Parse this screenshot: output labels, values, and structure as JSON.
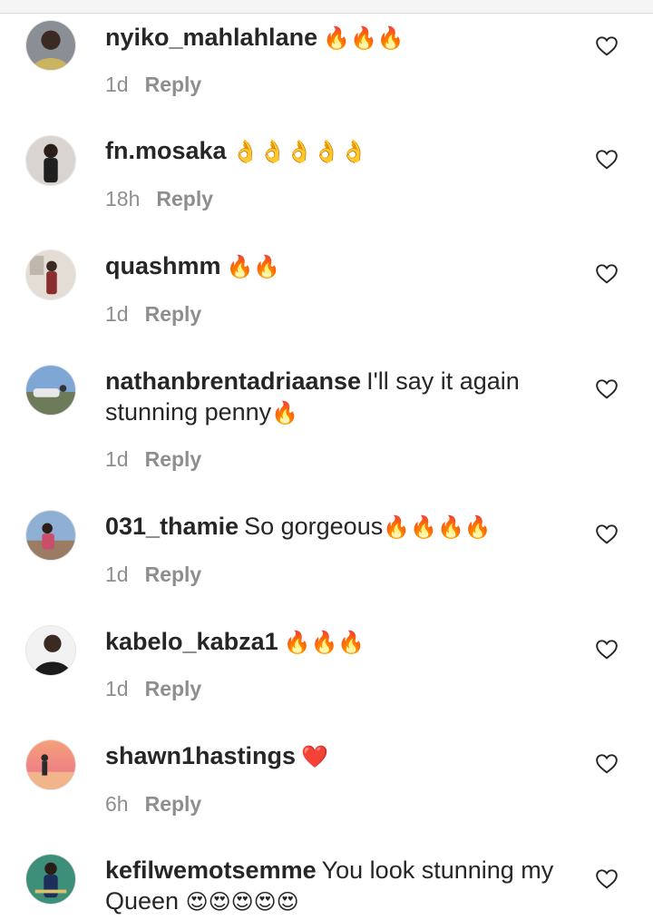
{
  "colors": {
    "text": "#262626",
    "meta": "#8e8e8e",
    "background": "#ffffff"
  },
  "icons": {
    "like": "heart-outline-icon",
    "fire": "🔥",
    "ok_hand": "👌",
    "red_heart": "❤️",
    "heart_eyes": "😍"
  },
  "comments": [
    {
      "username": "nyiko_mahlahlane",
      "text": "",
      "emoji": "🔥🔥🔥",
      "time": "1d",
      "reply_label": "Reply"
    },
    {
      "username": "fn.mosaka",
      "text": "",
      "emoji": "👌👌👌👌👌",
      "time": "18h",
      "reply_label": "Reply"
    },
    {
      "username": "quashmm",
      "text": "",
      "emoji": "🔥🔥",
      "time": "1d",
      "reply_label": "Reply"
    },
    {
      "username": "nathanbrentadriaanse",
      "text": "I'll say it again stunning penny",
      "emoji": "🔥",
      "time": "1d",
      "reply_label": "Reply"
    },
    {
      "username": "031_thamie",
      "text": "So gorgeous",
      "emoji": "🔥🔥🔥🔥",
      "time": "1d",
      "reply_label": "Reply"
    },
    {
      "username": "kabelo_kabza1",
      "text": "",
      "emoji": "🔥🔥🔥",
      "time": "1d",
      "reply_label": "Reply"
    },
    {
      "username": "shawn1hastings",
      "text": "",
      "emoji": "❤️",
      "time": "6h",
      "reply_label": "Reply"
    },
    {
      "username": "kefilwemotsemme",
      "text": "You look stunning my Queen",
      "emoji": "😍😍😍😍😍",
      "time": "",
      "reply_label": ""
    }
  ]
}
